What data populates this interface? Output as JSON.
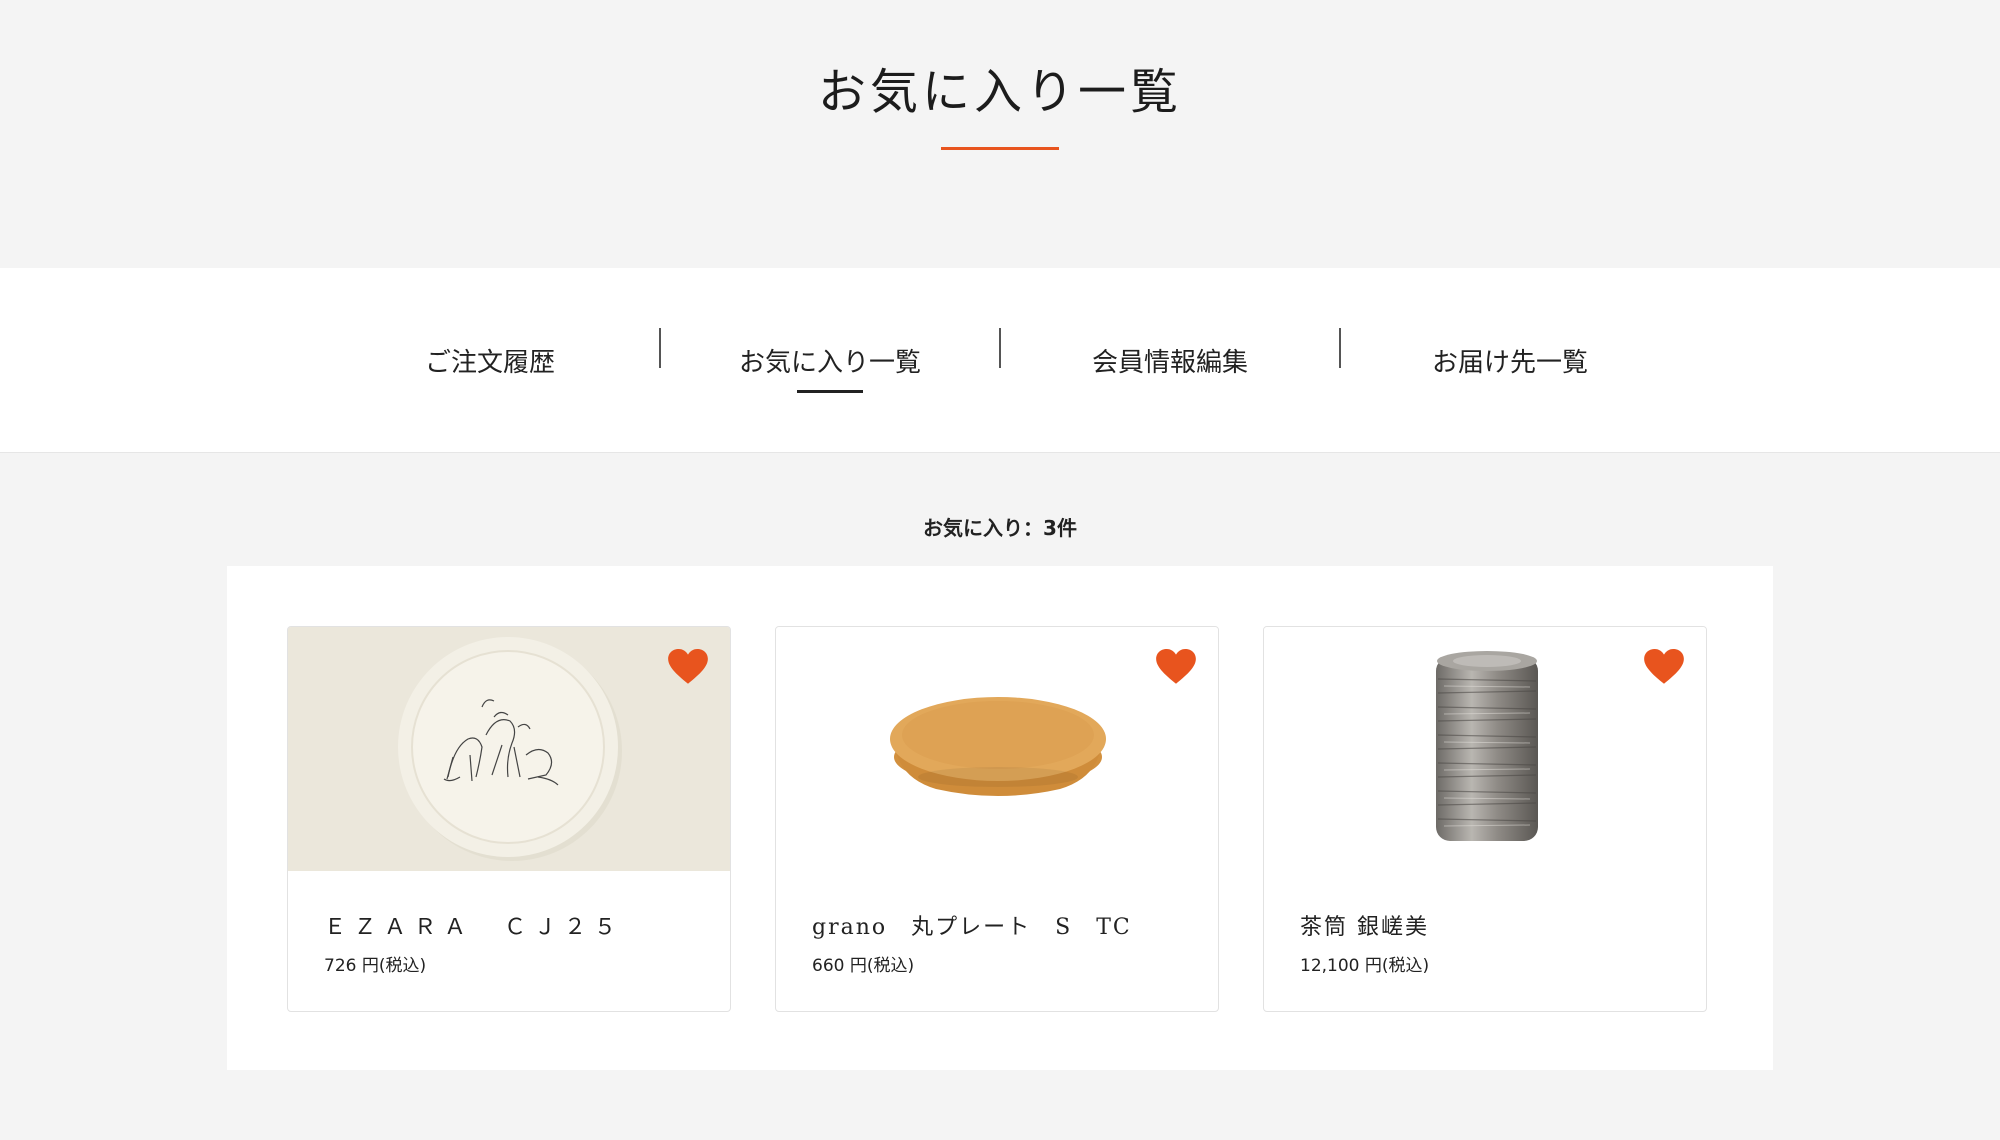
{
  "header": {
    "title": "お気に入り一覧"
  },
  "tabs": [
    {
      "label": "ご注文履歴",
      "active": false
    },
    {
      "label": "お気に入り一覧",
      "active": true
    },
    {
      "label": "会員情報編集",
      "active": false
    },
    {
      "label": "お届け先一覧",
      "active": false
    }
  ],
  "favorites": {
    "count_label": "お気に入り：3件",
    "items": [
      {
        "name": "ＥＺＡＲＡ　ＣＪ２５",
        "price": "726 円(税込)",
        "image": "plate-with-sketch-image",
        "favorited": true
      },
      {
        "name": "grano　丸プレート　S　TC",
        "price": "660 円(税込)",
        "image": "orange-round-plate-image",
        "favorited": true
      },
      {
        "name": "茶筒 銀嵯美",
        "price": "12,100 円(税込)",
        "image": "silver-tea-canister-image",
        "favorited": true
      }
    ]
  },
  "colors": {
    "accent": "#e8541e",
    "background": "#f4f4f4",
    "panel": "#ffffff"
  }
}
